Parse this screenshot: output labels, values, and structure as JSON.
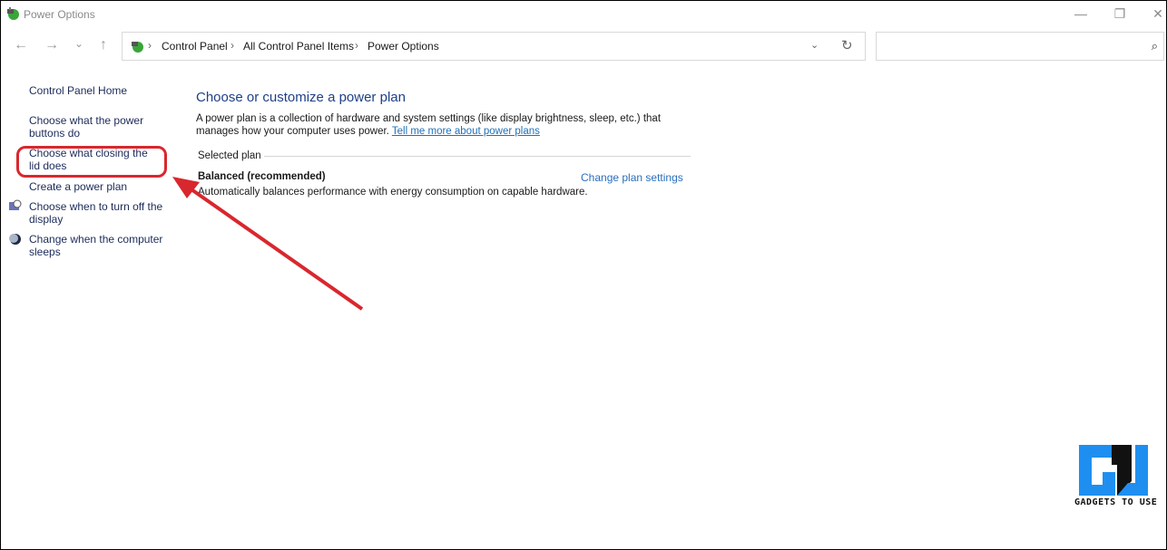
{
  "window": {
    "title": "Power Options",
    "minimize_icon": "minimize-icon",
    "restore_icon": "restore-icon",
    "close_icon": "close-icon"
  },
  "nav": {
    "back": "←",
    "forward": "→",
    "recent": "⌄",
    "up": "↑"
  },
  "address": {
    "crumbs": [
      "Control Panel",
      "All Control Panel Items",
      "Power Options"
    ],
    "separator": "›",
    "dropdown": "⌄",
    "refresh": "↻"
  },
  "search": {
    "placeholder": "",
    "icon": "⌕"
  },
  "sidebar": {
    "home": "Control Panel Home",
    "items": [
      {
        "label": "Choose what the power buttons do"
      },
      {
        "label": "Choose what closing the lid does"
      },
      {
        "label": "Create a power plan"
      },
      {
        "label": "Choose when to turn off the display",
        "icon": "display-clock-icon"
      },
      {
        "label": "Change when the computer sleeps",
        "icon": "moon-icon"
      }
    ]
  },
  "main": {
    "title": "Choose or customize a power plan",
    "description": "A power plan is a collection of hardware and system settings (like display brightness, sleep, etc.) that manages how your computer uses power.",
    "link": "Tell me more about power plans",
    "selected_label": "Selected plan",
    "plan_name": "Balanced (recommended)",
    "plan_description": "Automatically balances performance with energy consumption on capable hardware.",
    "change_link": "Change plan settings"
  },
  "watermark": {
    "text": "GADGETS TO USE",
    "brand_color": "#1e8ff0"
  },
  "colors": {
    "annotation": "#d9272e",
    "link": "#2a6ebd",
    "heading": "#1e3f87"
  }
}
